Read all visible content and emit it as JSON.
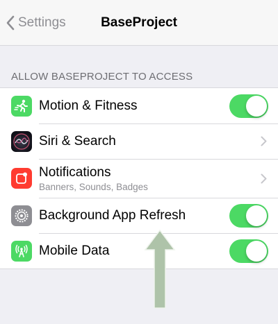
{
  "navbar": {
    "back_label": "Settings",
    "title": "BaseProject"
  },
  "section": {
    "header": "ALLOW BASEPROJECT TO ACCESS"
  },
  "rows": [
    {
      "label": "Motion & Fitness",
      "icon": "motion-fitness-icon",
      "icon_color": "#4cd964",
      "control": "toggle",
      "on": true
    },
    {
      "label": "Siri & Search",
      "icon": "siri-icon",
      "icon_color": "#1c1c1e",
      "control": "disclosure"
    },
    {
      "label": "Notifications",
      "subtitle": "Banners, Sounds, Badges",
      "icon": "notifications-icon",
      "icon_color": "#ff3b30",
      "control": "disclosure"
    },
    {
      "label": "Background App Refresh",
      "icon": "gear-icon",
      "icon_color": "#8e8e93",
      "control": "toggle",
      "on": true
    },
    {
      "label": "Mobile Data",
      "icon": "antenna-icon",
      "icon_color": "#4cd964",
      "control": "toggle",
      "on": true
    }
  ],
  "colors": {
    "toggle_on": "#4cd964",
    "background": "#efeff4",
    "annotation_arrow": "#aec3a9"
  }
}
